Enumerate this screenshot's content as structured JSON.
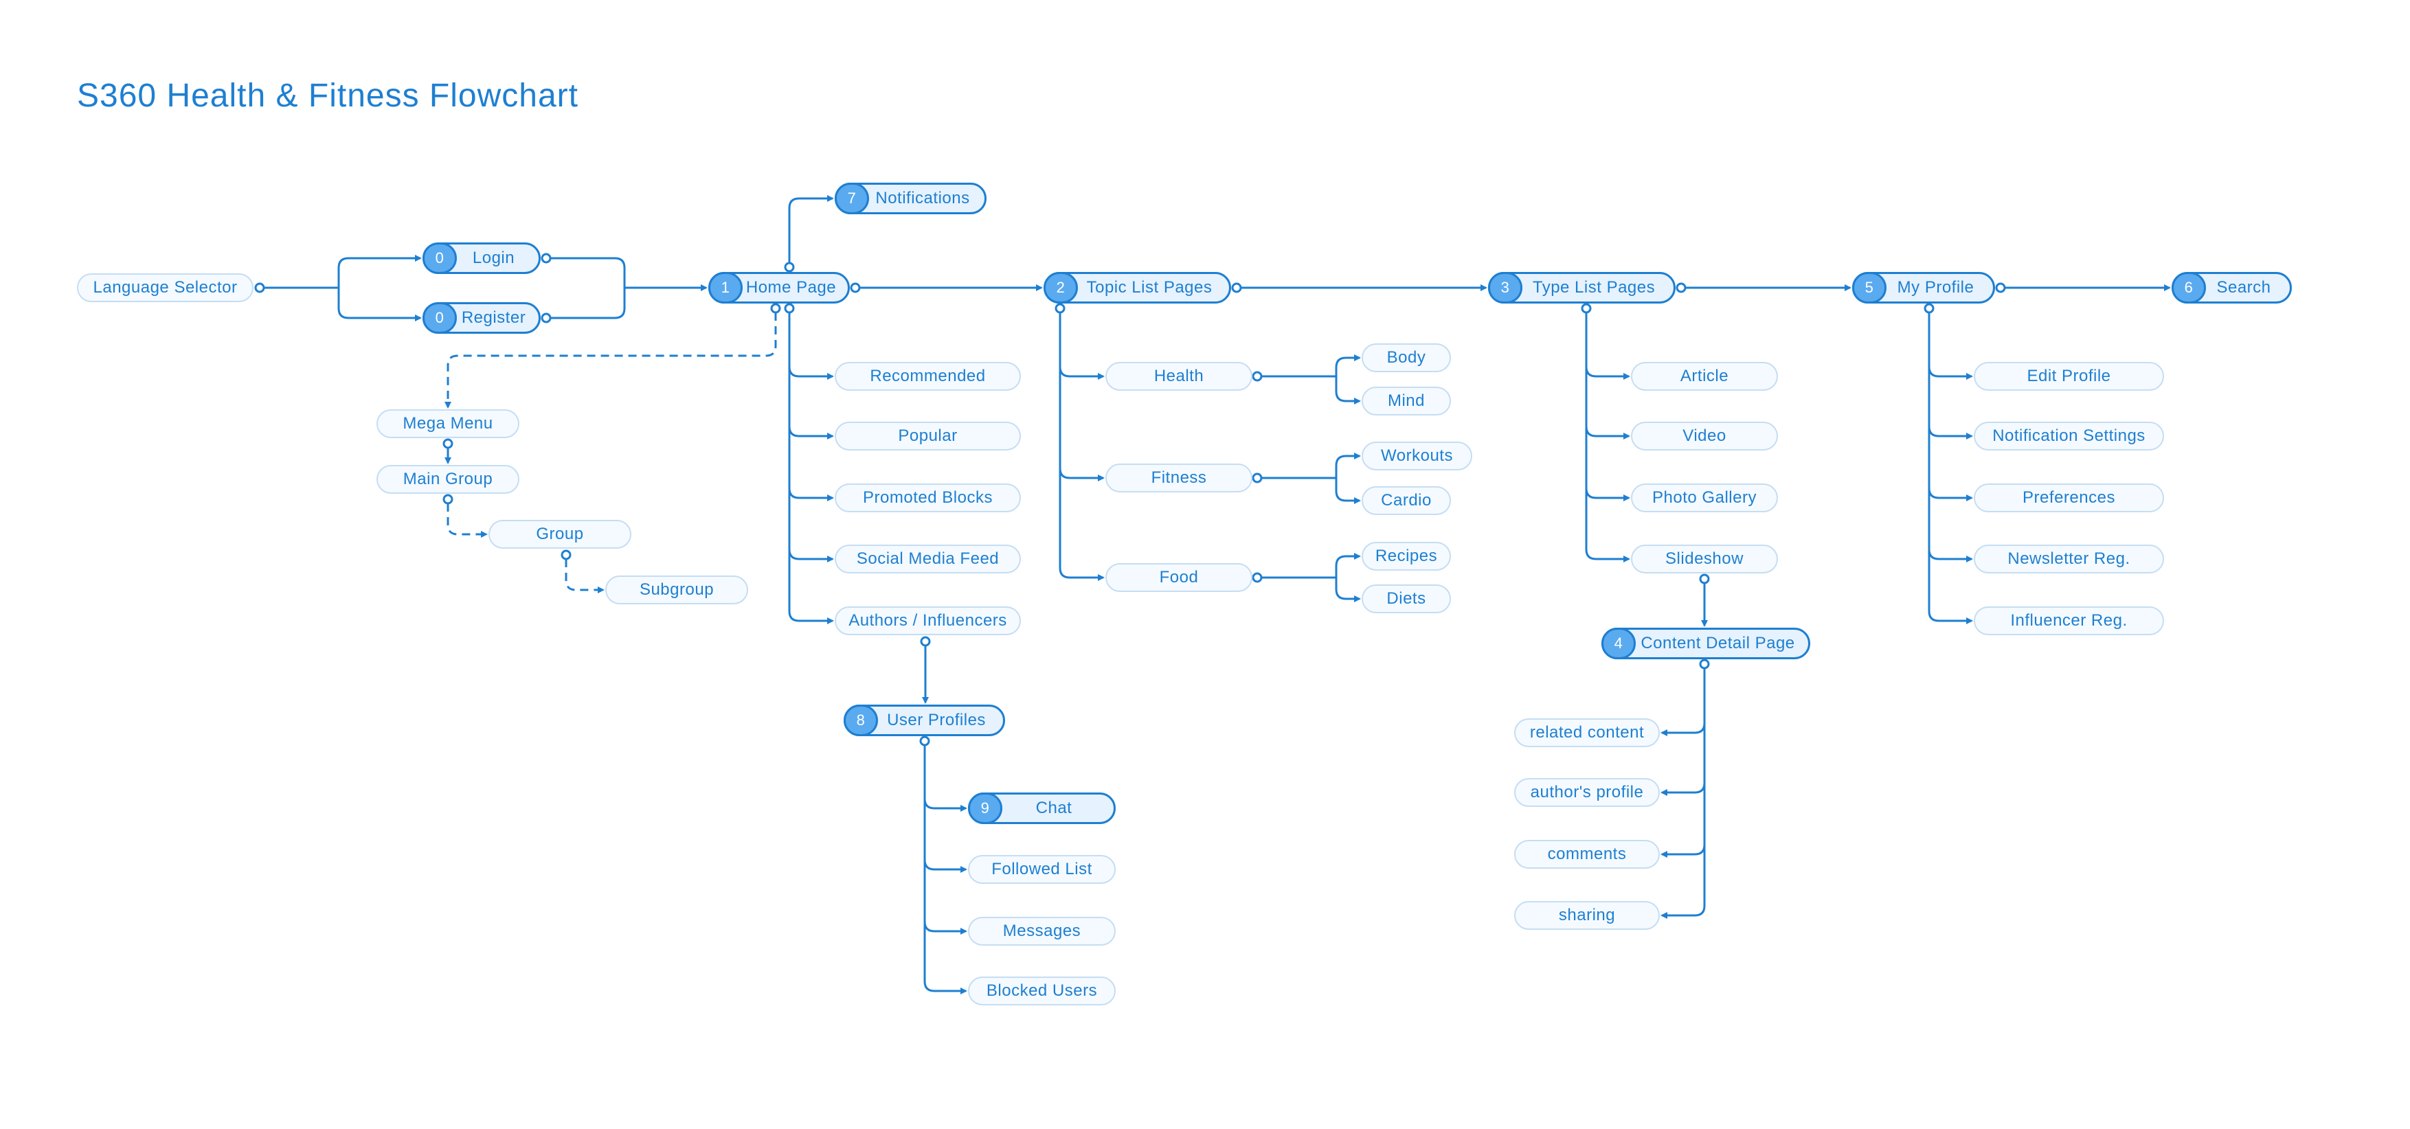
{
  "title": "S360 Health & Fitness Flowchart",
  "colors": {
    "line": "#1e7fd1",
    "main_fill": "#e6f2fd",
    "badge_fill": "#5aaaf0",
    "sub_fill": "#f4faff",
    "sub_border": "#c6ddf2",
    "text": "#1e7fd1"
  },
  "nodes": {
    "language_selector": {
      "label": "Language Selector"
    },
    "login": {
      "num": "0",
      "label": "Login"
    },
    "register": {
      "num": "0",
      "label": "Register"
    },
    "home": {
      "num": "1",
      "label": "Home Page"
    },
    "notifications": {
      "num": "7",
      "label": "Notifications"
    },
    "topic_list": {
      "num": "2",
      "label": "Topic List Pages"
    },
    "type_list": {
      "num": "3",
      "label": "Type List Pages"
    },
    "my_profile": {
      "num": "5",
      "label": "My Profile"
    },
    "search": {
      "num": "6",
      "label": "Search"
    },
    "content_detail": {
      "num": "4",
      "label": "Content Detail Page"
    },
    "user_profiles": {
      "num": "8",
      "label": "User Profiles"
    },
    "chat": {
      "num": "9",
      "label": "Chat"
    },
    "mega_menu": {
      "label": "Mega Menu"
    },
    "main_group": {
      "label": "Main Group"
    },
    "group": {
      "label": "Group"
    },
    "subgroup": {
      "label": "Subgroup"
    }
  },
  "home_children": [
    "Recommended",
    "Popular",
    "Promoted Blocks",
    "Social Media Feed",
    "Authors / Influencers"
  ],
  "topic_children": [
    {
      "label": "Health",
      "subs": [
        "Body",
        "Mind"
      ]
    },
    {
      "label": "Fitness",
      "subs": [
        "Workouts",
        "Cardio"
      ]
    },
    {
      "label": "Food",
      "subs": [
        "Recipes",
        "Diets"
      ]
    }
  ],
  "type_children": [
    "Article",
    "Video",
    "Photo Gallery",
    "Slideshow"
  ],
  "profile_children": [
    "Edit Profile",
    "Notification Settings",
    "Preferences",
    "Newsletter Reg.",
    "Influencer Reg."
  ],
  "detail_children": [
    "related content",
    "author's profile",
    "comments",
    "sharing"
  ],
  "user_profile_children": [
    "Followed List",
    "Messages",
    "Blocked Users"
  ]
}
